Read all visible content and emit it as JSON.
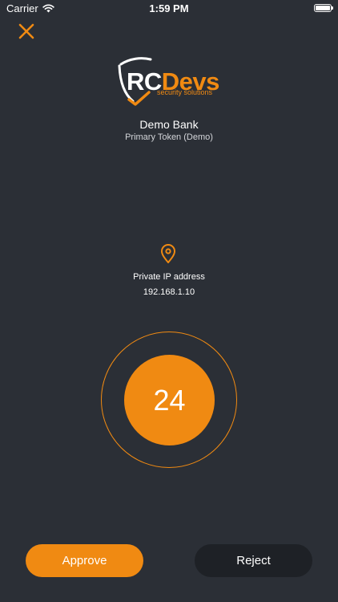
{
  "status_bar": {
    "carrier": "Carrier",
    "time": "1:59 PM",
    "battery_level": 1.0
  },
  "logo": {
    "rc": "RC",
    "devs": "Devs",
    "tagline": "security solutions"
  },
  "account": {
    "bank_name": "Demo Bank",
    "token_name": "Primary Token (Demo)"
  },
  "location": {
    "label": "Private IP address",
    "ip": "192.168.1.10"
  },
  "verification": {
    "code": "24"
  },
  "actions": {
    "approve_label": "Approve",
    "reject_label": "Reject"
  },
  "colors": {
    "background": "#2b2f36",
    "accent": "#f08a12",
    "reject_button": "#1e2126"
  },
  "icons": {
    "close": "close-icon",
    "location": "location-pin-icon",
    "wifi": "wifi-icon",
    "battery": "battery-icon"
  }
}
